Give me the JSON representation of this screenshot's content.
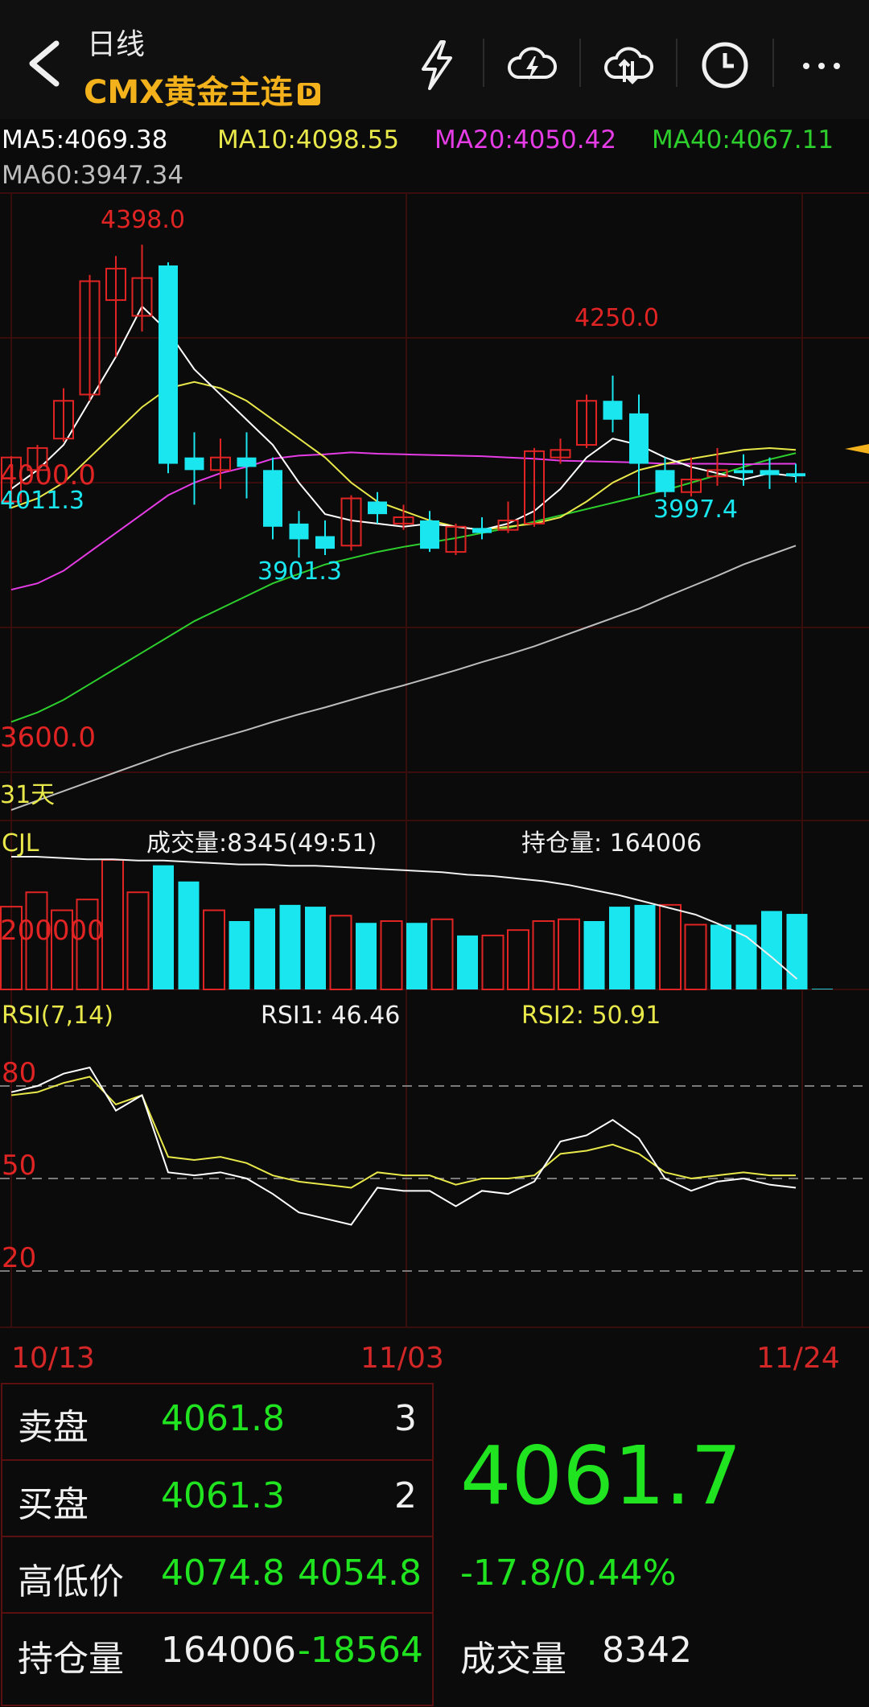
{
  "header": {
    "period": "日线",
    "symbol": "CMX黄金主连",
    "badge": "D"
  },
  "ma": {
    "ma5": "MA5:4069.38",
    "ma10": "MA10:4098.55",
    "ma20": "MA20:4050.42",
    "ma40": "MA40:4067.11",
    "ma60": "MA60:3947.34"
  },
  "colors": {
    "up": "#e02424",
    "down": "#19e6ee",
    "ma5": "#ffffff",
    "ma10": "#e8e84a",
    "ma20": "#e63ce6",
    "ma40": "#2dcf2d",
    "ma60": "#bdbdbd",
    "accent": "#f3b21b",
    "green_text": "#1fe41f"
  },
  "price_chart": {
    "annotations": {
      "high": "4398.0",
      "peak2": "4250.0",
      "low1": "3901.3",
      "low2": "3997.4",
      "left_close": "4011.3"
    },
    "axis_labels": {
      "top": "4000.0",
      "bottom": "3600.0"
    },
    "days_label": "31天",
    "ylim": [
      3560,
      4480
    ],
    "candles": [
      {
        "o": 3990,
        "c": 4060,
        "h": 4062,
        "l": 3985
      },
      {
        "o": 4040,
        "c": 4075,
        "h": 4080,
        "l": 4030
      },
      {
        "o": 4090,
        "c": 4150,
        "h": 4170,
        "l": 4085
      },
      {
        "o": 4160,
        "c": 4340,
        "h": 4350,
        "l": 4150
      },
      {
        "o": 4310,
        "c": 4360,
        "h": 4380,
        "l": 4220
      },
      {
        "o": 4285,
        "c": 4345,
        "h": 4398,
        "l": 4260
      },
      {
        "o": 4365,
        "c": 4050,
        "h": 4370,
        "l": 4035
      },
      {
        "o": 4060,
        "c": 4040,
        "h": 4100,
        "l": 3985
      },
      {
        "o": 4040,
        "c": 4060,
        "h": 4090,
        "l": 4010
      },
      {
        "o": 4060,
        "c": 4045,
        "h": 4100,
        "l": 3995
      },
      {
        "o": 4040,
        "c": 3950,
        "h": 4060,
        "l": 3930
      },
      {
        "o": 3955,
        "c": 3930,
        "h": 3975,
        "l": 3901
      },
      {
        "o": 3935,
        "c": 3915,
        "h": 3960,
        "l": 3905
      },
      {
        "o": 3920,
        "c": 3995,
        "h": 4000,
        "l": 3912
      },
      {
        "o": 3990,
        "c": 3970,
        "h": 4005,
        "l": 3955
      },
      {
        "o": 3955,
        "c": 3965,
        "h": 3985,
        "l": 3945
      },
      {
        "o": 3960,
        "c": 3915,
        "h": 3975,
        "l": 3910
      },
      {
        "o": 3910,
        "c": 3950,
        "h": 3955,
        "l": 3905
      },
      {
        "o": 3948,
        "c": 3940,
        "h": 3965,
        "l": 3930
      },
      {
        "o": 3945,
        "c": 3960,
        "h": 3990,
        "l": 3940
      },
      {
        "o": 3955,
        "c": 4070,
        "h": 4075,
        "l": 3950
      },
      {
        "o": 4060,
        "c": 4072,
        "h": 4090,
        "l": 4050
      },
      {
        "o": 4080,
        "c": 4150,
        "h": 4160,
        "l": 4075
      },
      {
        "o": 4150,
        "c": 4120,
        "h": 4190,
        "l": 4100
      },
      {
        "o": 4130,
        "c": 4050,
        "h": 4160,
        "l": 4000
      },
      {
        "o": 4040,
        "c": 4005,
        "h": 4060,
        "l": 3997
      },
      {
        "o": 4005,
        "c": 4025,
        "h": 4060,
        "l": 3998
      },
      {
        "o": 4030,
        "c": 4040,
        "h": 4075,
        "l": 4015
      },
      {
        "o": 4040,
        "c": 4035,
        "h": 4065,
        "l": 4015
      },
      {
        "o": 4040,
        "c": 4032,
        "h": 4060,
        "l": 4010
      },
      {
        "o": 4035,
        "c": 4030,
        "h": 4050,
        "l": 4020
      }
    ],
    "ma5_line": [
      4010,
      4040,
      4080,
      4150,
      4220,
      4300,
      4260,
      4200,
      4160,
      4120,
      4080,
      4020,
      3970,
      3960,
      3955,
      3950,
      3955,
      3950,
      3945,
      3955,
      3975,
      4010,
      4060,
      4090,
      4080,
      4060,
      4045,
      4035,
      4025,
      4035,
      4030
    ],
    "ma10_line": [
      3980,
      3995,
      4020,
      4060,
      4100,
      4140,
      4170,
      4180,
      4170,
      4150,
      4120,
      4090,
      4060,
      4020,
      3990,
      3975,
      3960,
      3950,
      3945,
      3950,
      3955,
      3965,
      3990,
      4020,
      4040,
      4050,
      4058,
      4065,
      4072,
      4075,
      4072
    ],
    "ma20_line": [
      3850,
      3860,
      3880,
      3910,
      3940,
      3970,
      4000,
      4020,
      4035,
      4045,
      4058,
      4063,
      4065,
      4068,
      4066,
      4065,
      4064,
      4063,
      4062,
      4060,
      4058,
      4055,
      4054,
      4053,
      4052,
      4050,
      4050,
      4050,
      4049,
      4050,
      4050
    ],
    "ma40_line": [
      3640,
      3655,
      3675,
      3700,
      3725,
      3750,
      3775,
      3800,
      3820,
      3840,
      3860,
      3875,
      3890,
      3900,
      3910,
      3918,
      3925,
      3932,
      3940,
      3948,
      3958,
      3968,
      3978,
      3988,
      3998,
      4008,
      4020,
      4032,
      4045,
      4057,
      4067
    ],
    "ma60_line": [
      3500,
      3515,
      3530,
      3545,
      3560,
      3575,
      3590,
      3603,
      3615,
      3627,
      3640,
      3652,
      3663,
      3675,
      3687,
      3698,
      3710,
      3722,
      3735,
      3747,
      3760,
      3775,
      3790,
      3805,
      3820,
      3838,
      3855,
      3872,
      3890,
      3905,
      3920
    ]
  },
  "volume_chart": {
    "label": "CJL",
    "volume_text": "成交量:8345(49:51)",
    "oi_text": "持仓量: 164006",
    "axis_label": "200000",
    "values": [
      230000,
      270000,
      220000,
      250000,
      360000,
      270000,
      345000,
      300000,
      220000,
      190000,
      225000,
      235000,
      230000,
      205000,
      185000,
      190000,
      185000,
      195000,
      150000,
      150000,
      165000,
      190000,
      195000,
      190000,
      230000,
      235000,
      235000,
      180000,
      180000,
      180000,
      218000,
      210000,
      2000
    ],
    "oi_line": [
      1.0,
      1.0,
      0.99,
      0.98,
      0.98,
      0.97,
      0.97,
      0.96,
      0.95,
      0.94,
      0.94,
      0.93,
      0.93,
      0.92,
      0.91,
      0.9,
      0.89,
      0.88,
      0.86,
      0.85,
      0.83,
      0.81,
      0.78,
      0.74,
      0.7,
      0.65,
      0.6,
      0.55,
      0.47,
      0.38,
      0.22,
      0.05
    ]
  },
  "rsi_chart": {
    "label": "RSI(7,14)",
    "rsi1_text": "RSI1: 46.46",
    "rsi2_text": "RSI2: 50.91",
    "levels": [
      "80",
      "50",
      "20"
    ],
    "rsi1": [
      78,
      80,
      84,
      86,
      72,
      77,
      52,
      51,
      52,
      50,
      45,
      39,
      37,
      35,
      47,
      46,
      46,
      41,
      46,
      45,
      49,
      62,
      64,
      69,
      63,
      50,
      46,
      49,
      50,
      48,
      47
    ],
    "rsi2": [
      77,
      78,
      81,
      83,
      74,
      77,
      57,
      56,
      57,
      55,
      51,
      49,
      48,
      47,
      52,
      51,
      51,
      48,
      50,
      50,
      51,
      58,
      59,
      61,
      58,
      52,
      50,
      51,
      52,
      51,
      51
    ]
  },
  "dates": [
    "10/13",
    "11/03",
    "11/24"
  ],
  "quote": {
    "ask_label": "卖盘",
    "ask_price": "4061.8",
    "ask_size": "3",
    "bid_label": "买盘",
    "bid_price": "4061.3",
    "bid_size": "2",
    "hl_label": "高低价",
    "high": "4074.8",
    "low": "4054.8",
    "oi_label": "持仓量",
    "oi": "164006",
    "oi_change": "-18564",
    "last_price": "4061.7",
    "change": "-17.8/0.44%",
    "vol_label": "成交量",
    "volume": "8342"
  }
}
